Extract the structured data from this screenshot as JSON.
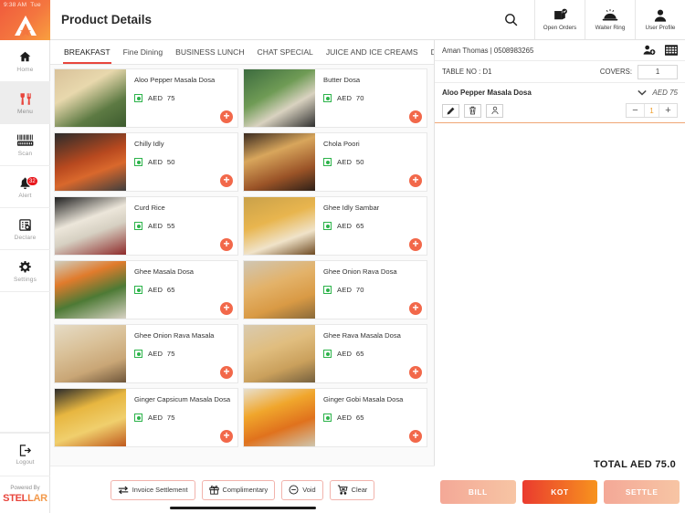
{
  "statusbar": {
    "time": "9:38 AM",
    "day": "Tue"
  },
  "brand": {
    "logo_letter": "A",
    "powered_by": "Powered By",
    "company": "STELLAR"
  },
  "sidebar": {
    "items": [
      {
        "label": "Home",
        "icon": "home-icon",
        "active": false
      },
      {
        "label": "Menu",
        "icon": "menu-icon",
        "active": true
      },
      {
        "label": "Scan",
        "icon": "barcode-icon",
        "active": false
      },
      {
        "label": "Alert",
        "icon": "bell-icon",
        "active": false,
        "badge": "32"
      },
      {
        "label": "Declare",
        "icon": "declare-icon",
        "active": false
      },
      {
        "label": "Settings",
        "icon": "gear-icon",
        "active": false
      }
    ],
    "logout": {
      "label": "Logout",
      "icon": "logout-icon"
    }
  },
  "header": {
    "title": "Product Details",
    "actions": [
      {
        "label": "",
        "icon": "search-icon"
      },
      {
        "label": "Open Orders",
        "icon": "open-orders-icon"
      },
      {
        "label": "Waiter Ring",
        "icon": "bell-desk-icon"
      },
      {
        "label": "User Profile",
        "icon": "user-icon"
      }
    ]
  },
  "tabs": [
    {
      "label": "BREAKFAST",
      "active": true
    },
    {
      "label": "Fine Dining",
      "active": false
    },
    {
      "label": "BUSINESS LUNCH",
      "active": false
    },
    {
      "label": "CHAT SPECIAL",
      "active": false
    },
    {
      "label": "JUICE AND ICE CREAMS",
      "active": false
    },
    {
      "label": "Desserts",
      "active": false
    }
  ],
  "products": [
    {
      "name": "Aloo Pepper Masala Dosa",
      "currency": "AED",
      "price": "75",
      "veg": true,
      "thumb": "t0"
    },
    {
      "name": "Butter Dosa",
      "currency": "AED",
      "price": "70",
      "veg": true,
      "thumb": "t1"
    },
    {
      "name": "Chilly Idly",
      "currency": "AED",
      "price": "50",
      "veg": true,
      "thumb": "t2"
    },
    {
      "name": "Chola Poori",
      "currency": "AED",
      "price": "50",
      "veg": true,
      "thumb": "t3"
    },
    {
      "name": "Curd Rice",
      "currency": "AED",
      "price": "55",
      "veg": true,
      "thumb": "t4"
    },
    {
      "name": "Ghee Idly Sambar",
      "currency": "AED",
      "price": "65",
      "veg": true,
      "thumb": "t5"
    },
    {
      "name": "Ghee Masala Dosa",
      "currency": "AED",
      "price": "65",
      "veg": true,
      "thumb": "t6"
    },
    {
      "name": "Ghee Onion Rava Dosa",
      "currency": "AED",
      "price": "70",
      "veg": true,
      "thumb": "t7"
    },
    {
      "name": "Ghee Onion Rava Masala",
      "currency": "AED",
      "price": "75",
      "veg": true,
      "thumb": "t8"
    },
    {
      "name": "Ghee Rava Masala Dosa",
      "currency": "AED",
      "price": "65",
      "veg": true,
      "thumb": "t9"
    },
    {
      "name": "Ginger Capsicum Masala Dosa",
      "currency": "AED",
      "price": "75",
      "veg": true,
      "thumb": "t10"
    },
    {
      "name": "Ginger Gobi Masala Dosa",
      "currency": "AED",
      "price": "65",
      "veg": true,
      "thumb": "t11"
    }
  ],
  "order": {
    "customer": "Aman  Thomas | 0508983265",
    "add_customer_icon": "add-person-icon",
    "table_layout_icon": "table-grid-icon",
    "table_label": "TABLE NO :  D1",
    "covers_label": "COVERS:",
    "covers_value": "1",
    "items": [
      {
        "name": "Aloo Pepper Masala Dosa",
        "price_text": "AED 75",
        "qty": "1",
        "edit_icon": "pencil-icon",
        "delete_icon": "trash-icon",
        "seat_icon": "person-icon",
        "minus": "−",
        "plus": "+"
      }
    ],
    "total_text": "TOTAL  AED 75.0",
    "buttons": [
      {
        "label": "BILL",
        "style": "bill"
      },
      {
        "label": "KOT",
        "style": "kot"
      },
      {
        "label": "SETTLE",
        "style": "settle"
      }
    ]
  },
  "bottom_actions": [
    {
      "label": "Invoice Settlement",
      "icon": "transfer-icon"
    },
    {
      "label": "Complimentary",
      "icon": "gift-icon"
    },
    {
      "label": "Void",
      "icon": "minus-circle-icon"
    },
    {
      "label": "Clear",
      "icon": "cart-clear-icon"
    }
  ],
  "colors": {
    "accent": "#e8453c",
    "orange": "#f2684a",
    "veg_green": "#2cb34a",
    "qty_amber": "#f0a030"
  }
}
